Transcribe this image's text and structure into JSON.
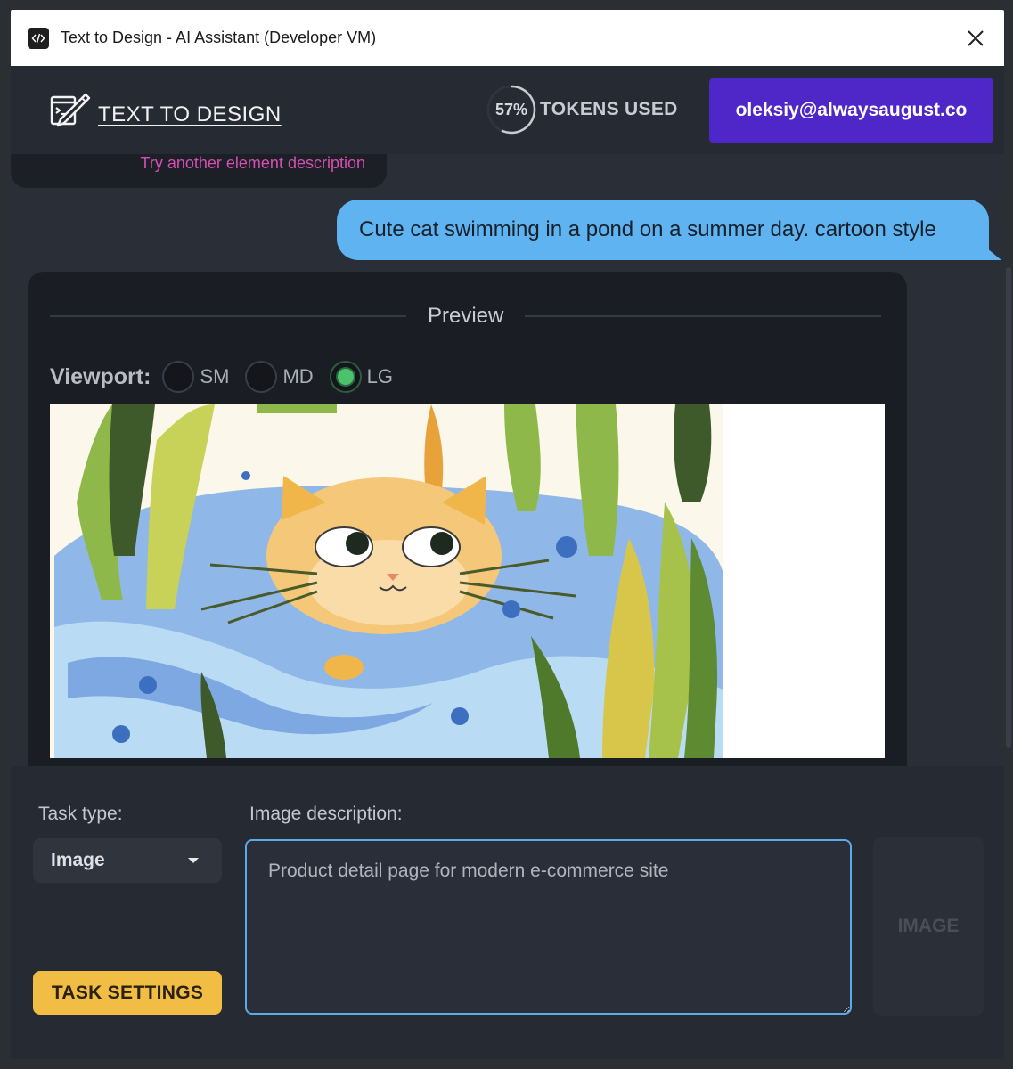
{
  "window": {
    "title": "Text to Design - AI Assistant (Developer VM)"
  },
  "header": {
    "brand": "TEXT TO DESIGN",
    "tokens_percent": 57,
    "tokens_percent_label": "57%",
    "tokens_label": "TOKENS USED",
    "user_email": "oleksiy@alwaysaugust.co"
  },
  "chat": {
    "previous_hint": "Try another element description",
    "user_message": "Cute cat swimming in a pond on a summer day. cartoon style"
  },
  "preview": {
    "title": "Preview",
    "viewport_label": "Viewport:",
    "viewport_options": [
      {
        "label": "SM",
        "checked": false
      },
      {
        "label": "MD",
        "checked": false
      },
      {
        "label": "LG",
        "checked": true
      }
    ]
  },
  "form": {
    "task_type_label": "Task type:",
    "task_type_value": "Image",
    "image_description_label": "Image description:",
    "image_description_placeholder": "Product detail page for modern e-commerce site",
    "task_settings_label": "TASK SETTINGS",
    "submit_label": "IMAGE"
  },
  "colors": {
    "accent_purple": "#4f27c9",
    "accent_yellow": "#f2bd45",
    "user_bubble": "#5eb3f0",
    "hint_pink": "#d64fb3",
    "radio_green": "#4cc26a"
  }
}
